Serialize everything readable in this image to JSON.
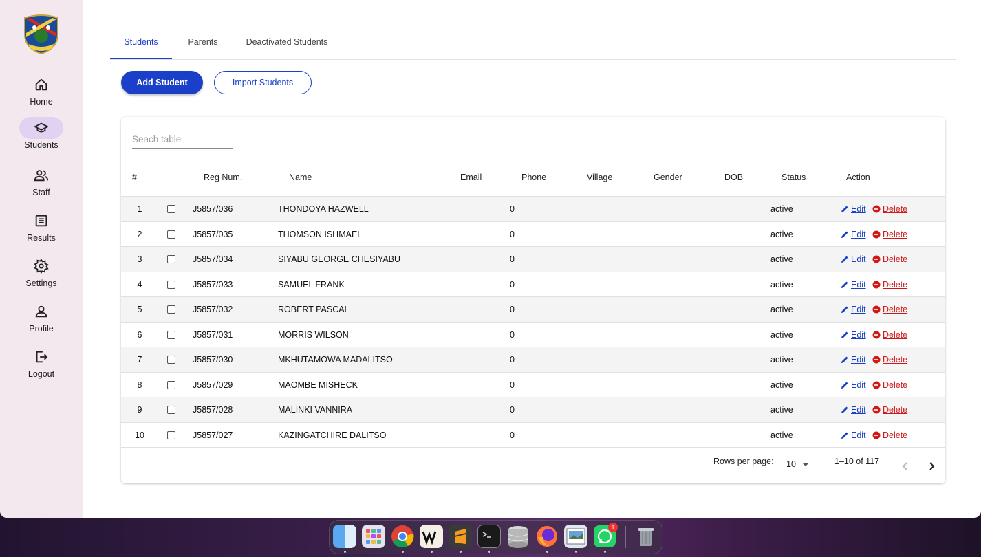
{
  "sidebar": {
    "items": [
      {
        "label": "Home",
        "icon": "home-icon"
      },
      {
        "label": "Students",
        "icon": "graduation-cap-icon",
        "active": true
      },
      {
        "label": "Staff",
        "icon": "people-icon"
      },
      {
        "label": "Results",
        "icon": "list-icon"
      },
      {
        "label": "Settings",
        "icon": "gear-icon"
      },
      {
        "label": "Profile",
        "icon": "person-icon"
      },
      {
        "label": "Logout",
        "icon": "logout-icon"
      }
    ]
  },
  "tabs": [
    {
      "label": "Students",
      "active": true
    },
    {
      "label": "Parents"
    },
    {
      "label": "Deactivated Students"
    }
  ],
  "actions": {
    "add_label": "Add Student",
    "import_label": "Import Students"
  },
  "table": {
    "search_placeholder": "Seach table",
    "headers": {
      "num": "#",
      "reg": "Reg Num.",
      "name": "Name",
      "email": "Email",
      "phone": "Phone",
      "village": "Village",
      "gender": "Gender",
      "dob": "DOB",
      "status": "Status",
      "action": "Action"
    },
    "edit_label": "Edit",
    "delete_label": "Delete",
    "rows": [
      {
        "num": "1",
        "reg": "J5857/036",
        "name": "THONDOYA HAZWELL",
        "phone": "0",
        "status": "active"
      },
      {
        "num": "2",
        "reg": "J5857/035",
        "name": "THOMSON ISHMAEL",
        "phone": "0",
        "status": "active"
      },
      {
        "num": "3",
        "reg": "J5857/034",
        "name": "SIYABU GEORGE CHESIYABU",
        "phone": "0",
        "status": "active"
      },
      {
        "num": "4",
        "reg": "J5857/033",
        "name": "SAMUEL FRANK",
        "phone": "0",
        "status": "active"
      },
      {
        "num": "5",
        "reg": "J5857/032",
        "name": "ROBERT PASCAL",
        "phone": "0",
        "status": "active"
      },
      {
        "num": "6",
        "reg": "J5857/031",
        "name": "MORRIS WILSON",
        "phone": "0",
        "status": "active"
      },
      {
        "num": "7",
        "reg": "J5857/030",
        "name": "MKHUTAMOWA MADALITSO",
        "phone": "0",
        "status": "active"
      },
      {
        "num": "8",
        "reg": "J5857/029",
        "name": "MAOMBE MISHECK",
        "phone": "0",
        "status": "active"
      },
      {
        "num": "9",
        "reg": "J5857/028",
        "name": "MALINKI VANNIRA",
        "phone": "0",
        "status": "active"
      },
      {
        "num": "10",
        "reg": "J5857/027",
        "name": "KAZINGATCHIRE DALITSO",
        "phone": "0",
        "status": "active"
      }
    ],
    "pagination": {
      "rows_per_page_label": "Rows per page:",
      "rows_per_page_value": "10",
      "range": "1–10 of 117"
    }
  },
  "dock": {
    "apps": [
      "finder-icon",
      "launchpad-icon",
      "chrome-icon",
      "webstorm-icon",
      "sublime-icon",
      "terminal-icon",
      "database-icon",
      "firefox-icon",
      "preview-icon",
      "whatsapp-icon",
      "trash-icon"
    ],
    "whatsapp_badge": "1"
  },
  "colors": {
    "accent": "#1a3fc8",
    "danger": "#d01818",
    "sidebar_bg": "#f3e8ee"
  }
}
